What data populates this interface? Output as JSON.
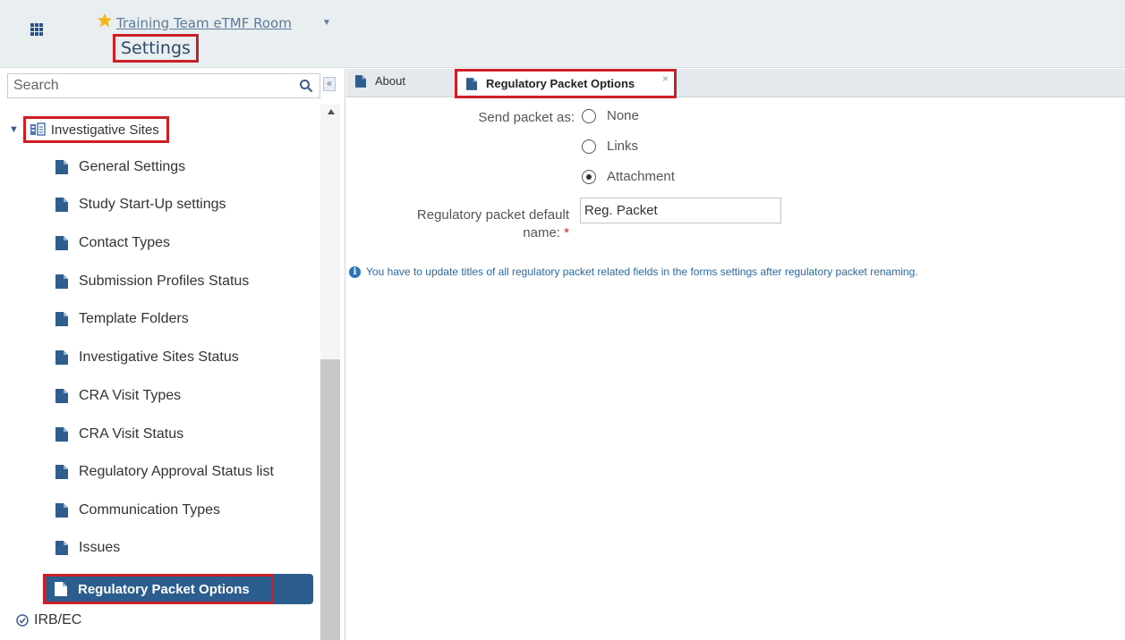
{
  "header": {
    "room_name": "Training Team eTMF Room",
    "page_title": "Settings"
  },
  "sidebar": {
    "search": {
      "placeholder": "Search"
    },
    "tree_root": {
      "label": "Investigative Sites",
      "expanded": true
    },
    "items": [
      {
        "label": "General Settings"
      },
      {
        "label": "Study Start-Up settings"
      },
      {
        "label": "Contact Types"
      },
      {
        "label": "Submission Profiles Status"
      },
      {
        "label": "Template Folders"
      },
      {
        "label": "Investigative Sites Status"
      },
      {
        "label": "CRA Visit Types"
      },
      {
        "label": "CRA Visit Status"
      },
      {
        "label": "Regulatory Approval Status list"
      },
      {
        "label": "Communication Types"
      },
      {
        "label": "Issues"
      }
    ],
    "selected_item": {
      "label": "Regulatory Packet Options"
    },
    "next_root": {
      "label": "IRB/EC"
    }
  },
  "tabs": [
    {
      "label": "About",
      "active": false
    },
    {
      "label": "Regulatory Packet Options",
      "active": true,
      "close": "×"
    }
  ],
  "form": {
    "send_packet": {
      "label": "Send packet as:",
      "options": [
        {
          "label": "None",
          "checked": false
        },
        {
          "label": "Links",
          "checked": false
        },
        {
          "label": "Attachment",
          "checked": true
        }
      ]
    },
    "packet_name": {
      "label_line1": "Regulatory packet default",
      "label_line2": "name:",
      "required_mark": "*",
      "value": "Reg. Packet"
    },
    "info_message": "You have to update titles of all regulatory packet related fields in the forms settings after regulatory packet renaming."
  },
  "colors": {
    "accent_red": "#cc1f25",
    "selected_bg": "#2c5d8f",
    "header_bg": "#e9eef0",
    "info_blue": "#2a6aa3"
  }
}
